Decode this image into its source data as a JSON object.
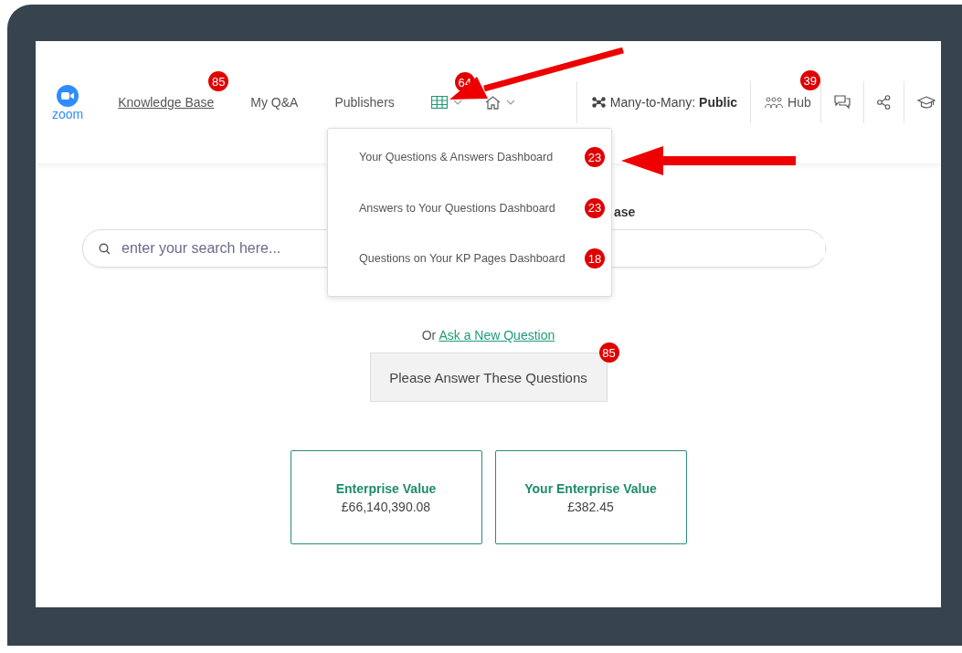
{
  "logo": {
    "text": "zoom"
  },
  "nav": [
    {
      "label": "Knowledge Base",
      "selected": true,
      "badge": "85"
    },
    {
      "label": "My Q&A",
      "selected": false
    },
    {
      "label": "Publishers",
      "selected": false
    }
  ],
  "icon_menus": [
    {
      "kind": "grid",
      "badge": "64"
    },
    {
      "kind": "home"
    }
  ],
  "dropdown": {
    "items": [
      {
        "label": "Your Questions & Answers Dashboard",
        "badge": "23"
      },
      {
        "label": "Answers to Your Questions Dashboard",
        "badge": "23"
      },
      {
        "label": "Questions on Your KP Pages Dashboard",
        "badge": "18"
      }
    ]
  },
  "mode": {
    "label": "Many-to-Many:",
    "value": "Public"
  },
  "hub": {
    "label": "Hub",
    "badge": "39"
  },
  "tool_icons": [
    {
      "kind": "chat"
    },
    {
      "kind": "share"
    },
    {
      "kind": "education"
    }
  ],
  "heading_fragment": "ase",
  "search": {
    "placeholder": "enter your search here..."
  },
  "ask": {
    "prefix": "Or",
    "link": "Ask a New Question"
  },
  "answer_button": {
    "label": "Please Answer These Questions",
    "badge": "85"
  },
  "cards": [
    {
      "title": "Enterprise Value",
      "value": "£66,140,390.08"
    },
    {
      "title": "Your Enterprise Value",
      "value": "£382.45"
    }
  ]
}
